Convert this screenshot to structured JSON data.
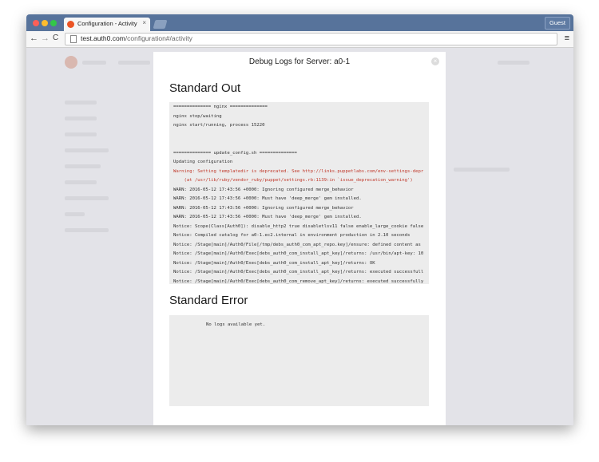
{
  "browser": {
    "tab_title": "Configuration - Activity",
    "tab_close": "×",
    "profile_label": "Guest",
    "url_host": "test.auth0.com",
    "url_path": "/configuration#/activity",
    "back_icon": "←",
    "forward_icon": "→",
    "reload_icon": "C",
    "menu_icon": "≡"
  },
  "modal": {
    "title": "Debug Logs for Server: a0-1",
    "close_icon": "×",
    "stdout_title": "Standard Out",
    "stderr_title": "Standard Error",
    "stderr_text": "No logs available yet.",
    "stdout_lines": [
      {
        "text": "============== nginx ==============",
        "warn": false
      },
      {
        "text": "nginx stop/waiting",
        "warn": false
      },
      {
        "text": "nginx start/running, process 15220",
        "warn": false
      },
      {
        "text": "",
        "warn": false
      },
      {
        "text": "",
        "warn": false
      },
      {
        "text": "============== update_config.sh ==============",
        "warn": false
      },
      {
        "text": "Updating configuration",
        "warn": false
      },
      {
        "text": "Warning: Setting templatedir is deprecated. See http://links.puppetlabs.com/env-settings-depr",
        "warn": true
      },
      {
        "text": "    (at /usr/lib/ruby/vendor_ruby/puppet/settings.rb:1139:in `issue_deprecation_warning')",
        "warn": true
      },
      {
        "text": "WARN: 2016-05-12 17:43:56 +0000: Ignoring configured merge_behavior",
        "warn": false
      },
      {
        "text": "WARN: 2016-05-12 17:43:56 +0000: Must have 'deep_merge' gem installed.",
        "warn": false
      },
      {
        "text": "WARN: 2016-05-12 17:43:56 +0000: Ignoring configured merge_behavior",
        "warn": false
      },
      {
        "text": "WARN: 2016-05-12 17:43:56 +0000: Must have 'deep_merge' gem installed.",
        "warn": false
      },
      {
        "text": "Notice: Scope(Class[Auth0]): disable_http2 true disabletlsv11 false enable_large_cookie false",
        "warn": false
      },
      {
        "text": "Notice: Compiled catalog for a0-1.ec2.internal in environment production in 2.10 seconds",
        "warn": false
      },
      {
        "text": "Notice: /Stage[main]/Auth0/File[/tmp/debs_auth0_com_apt_repo.key]/ensure: defined content as",
        "warn": false
      },
      {
        "text": "Notice: /Stage[main]/Auth0/Exec[debs_auth0_com_install_apt_key]/returns: /usr/bin/apt-key: 10",
        "warn": false
      },
      {
        "text": "Notice: /Stage[main]/Auth0/Exec[debs_auth0_com_install_apt_key]/returns: OK",
        "warn": false
      },
      {
        "text": "Notice: /Stage[main]/Auth0/Exec[debs_auth0_com_install_apt_key]/returns: executed successfull",
        "warn": false
      },
      {
        "text": "Notice: /Stage[main]/Auth0/Exec[debs_auth0_com_remove_apt_key]/returns: executed successfully",
        "warn": false
      }
    ]
  },
  "colors": {
    "titlebar": "#57739b",
    "warning_text": "#c0392b",
    "auth0_brand": "#eb5424"
  }
}
